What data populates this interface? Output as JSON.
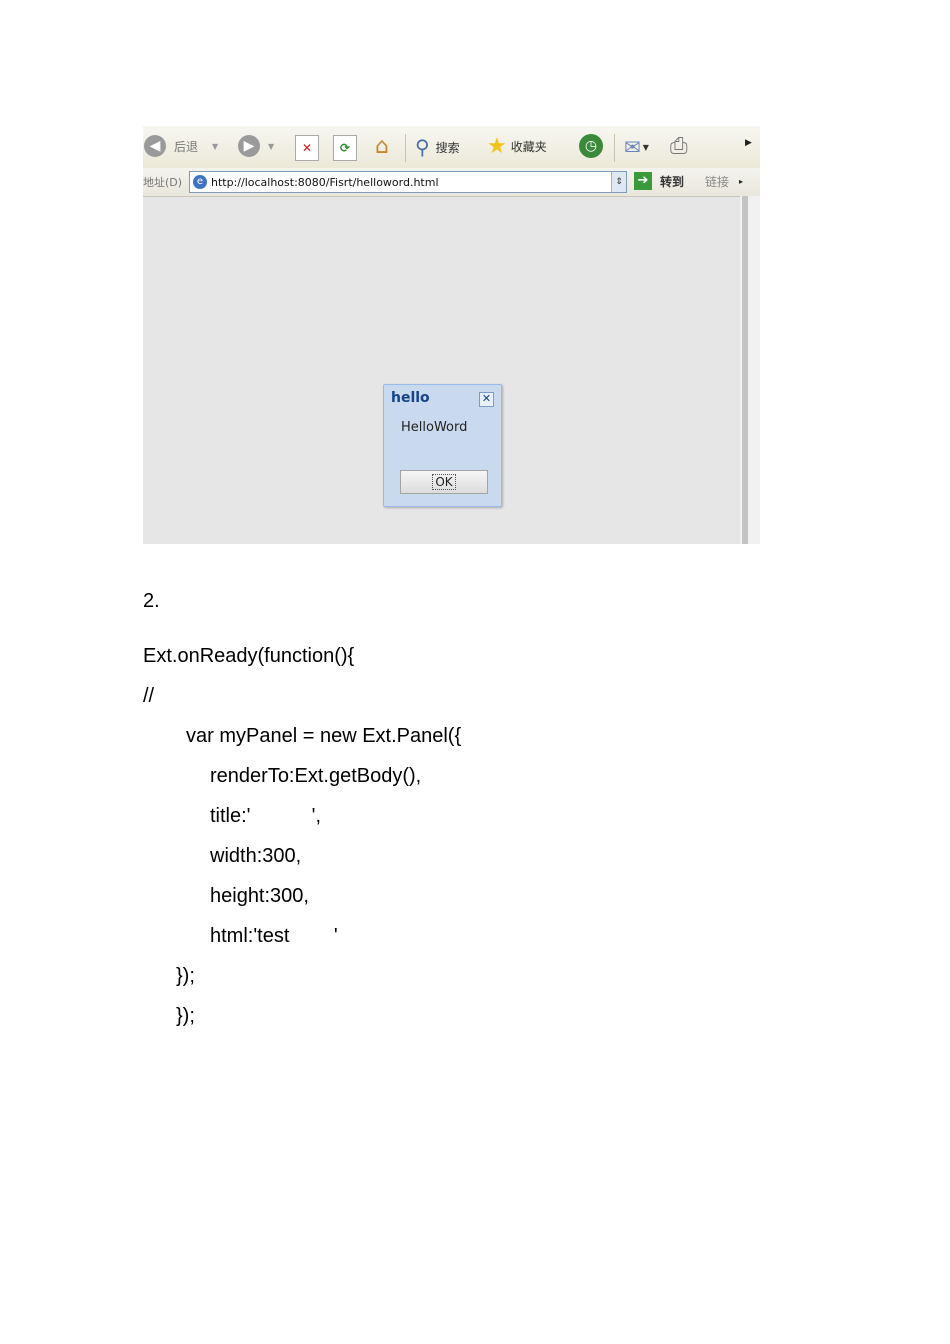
{
  "browser": {
    "toolbar": {
      "back_label": "后退",
      "search_label": "搜索",
      "favorites_label": "收藏夹"
    },
    "address": {
      "label": "地址(D)",
      "url": "http://localhost:8080/Fisrt/helloword.html",
      "go_label": "转到",
      "links_label": "链接"
    },
    "dialog": {
      "title": "hello",
      "message": "HelloWord",
      "ok_label": "OK"
    }
  },
  "document": {
    "step_number": "2.",
    "code_lines": [
      "Ext.onReady(function(){",
      "//",
      "var myPanel = new Ext.Panel({",
      "renderTo:Ext.getBody(),",
      "title:'           ',",
      "width:300,",
      "height:300,",
      "html:'test        '",
      "});",
      "});"
    ]
  }
}
